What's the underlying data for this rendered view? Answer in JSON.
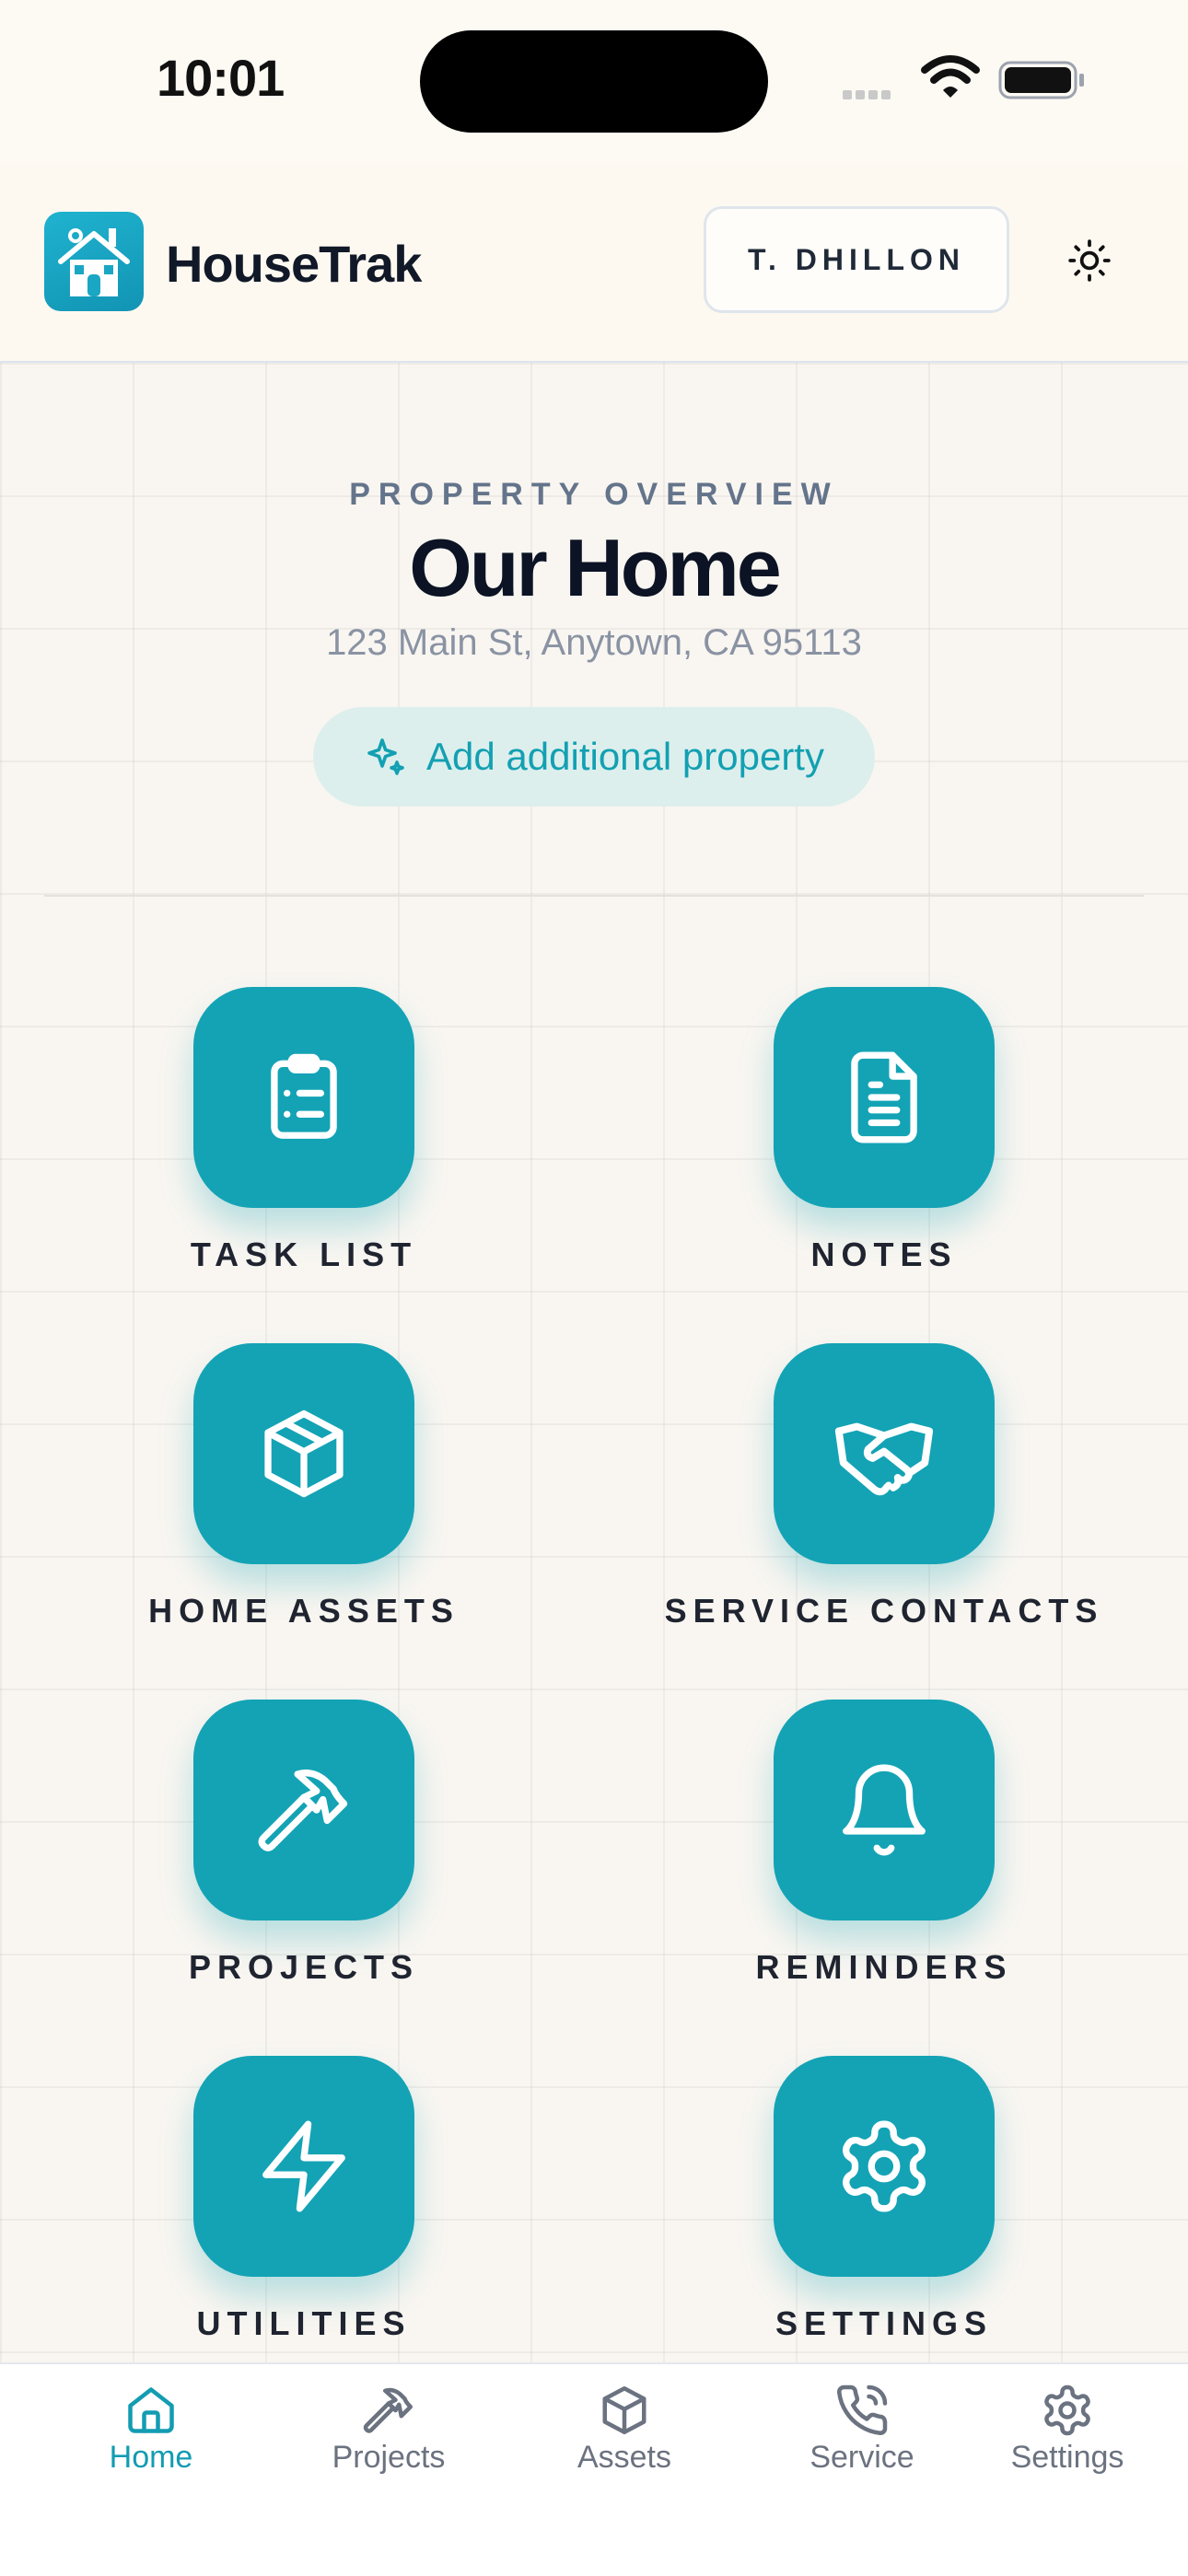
{
  "status_bar": {
    "time": "10:01"
  },
  "header": {
    "brand": "HouseTrak",
    "user_label": "T. DHILLON"
  },
  "overview": {
    "label": "PROPERTY OVERVIEW",
    "name": "Our Home",
    "address": "123 Main St, Anytown, CA 95113",
    "add_property": "Add additional property"
  },
  "tiles": [
    {
      "label": "TASK LIST",
      "icon": "clipboard-list-icon"
    },
    {
      "label": "NOTES",
      "icon": "file-text-icon"
    },
    {
      "label": "HOME ASSETS",
      "icon": "box-icon"
    },
    {
      "label": "SERVICE CONTACTS",
      "icon": "handshake-icon"
    },
    {
      "label": "PROJECTS",
      "icon": "hammer-icon"
    },
    {
      "label": "REMINDERS",
      "icon": "bell-icon"
    },
    {
      "label": "UTILITIES",
      "icon": "zap-icon"
    },
    {
      "label": "SETTINGS",
      "icon": "gear-icon"
    }
  ],
  "bottom_nav": [
    {
      "label": "Home",
      "icon": "home-icon",
      "active": true
    },
    {
      "label": "Projects",
      "icon": "hammer-icon",
      "active": false
    },
    {
      "label": "Assets",
      "icon": "box-icon",
      "active": false
    },
    {
      "label": "Service",
      "icon": "phone-icon",
      "active": false
    },
    {
      "label": "Settings",
      "icon": "gear-icon",
      "active": false
    }
  ],
  "colors": {
    "accent": "#13a3b5",
    "background": "#fdf9f3",
    "nav_active": "#139cb2",
    "nav_inactive": "#6b7280"
  }
}
